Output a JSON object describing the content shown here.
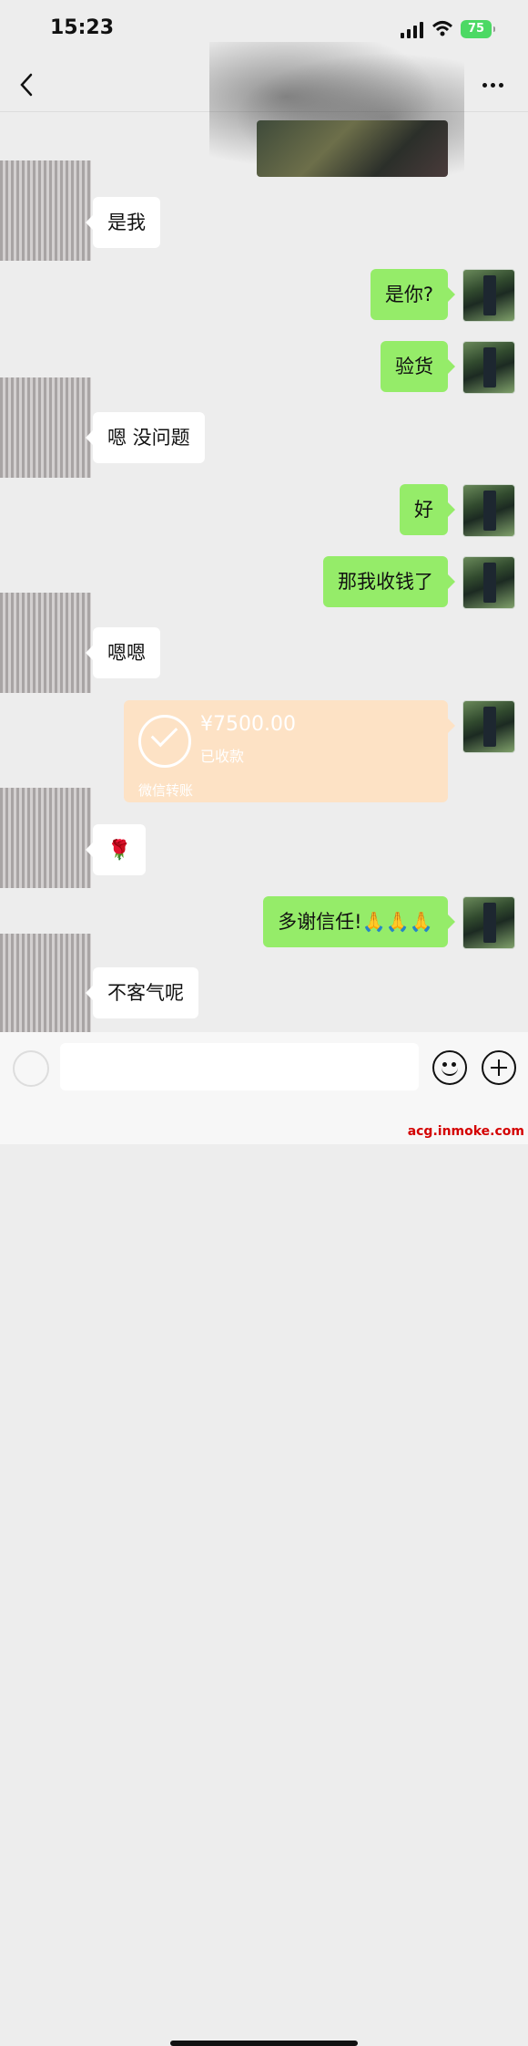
{
  "status_bar": {
    "time": "15:23",
    "battery": "75"
  },
  "nav": {
    "back_icon": "chevron-left-icon",
    "more_icon": "more-dots-icon"
  },
  "messages": [
    {
      "from": "them",
      "text": "是我"
    },
    {
      "from": "me",
      "text": "是你?"
    },
    {
      "from": "me",
      "text": "验货"
    },
    {
      "from": "them",
      "text": "嗯 没问题"
    },
    {
      "from": "me",
      "text": "好"
    },
    {
      "from": "me",
      "text": "那我收钱了"
    },
    {
      "from": "them",
      "text": "嗯嗯"
    },
    {
      "from": "me",
      "type": "transfer",
      "amount": "¥7500.00",
      "status": "已收款",
      "label": "微信转账"
    },
    {
      "from": "them",
      "text": "🌹"
    },
    {
      "from": "me",
      "text": "多谢信任!🙏🙏🙏"
    },
    {
      "from": "them",
      "text": "不客气呢"
    }
  ],
  "input_bar": {
    "voice_icon": "voice-icon",
    "emoji_icon": "emoji-icon",
    "plus_icon": "plus-icon"
  },
  "watermark": "acg.inmoke.com"
}
